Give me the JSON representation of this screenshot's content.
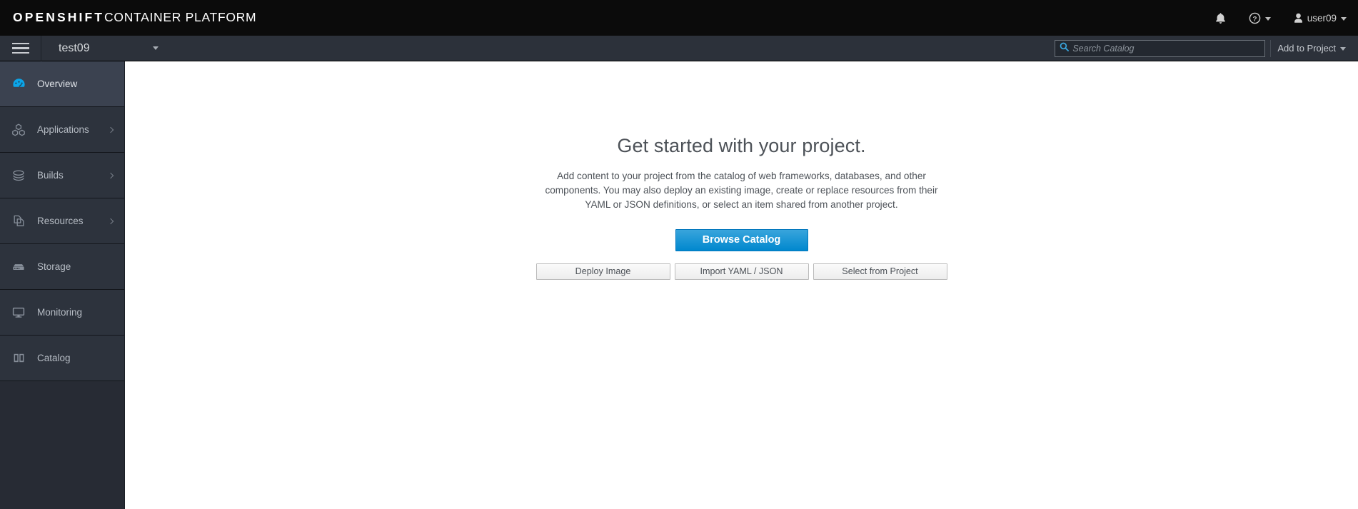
{
  "masthead": {
    "brand_bold": "OPENSHIFT",
    "brand_light": "CONTAINER PLATFORM",
    "notifications_icon": "bell-icon",
    "help_icon": "help-circle-icon",
    "user_icon": "user-icon",
    "username": "user09"
  },
  "toolbar": {
    "menu_icon": "hamburger-icon",
    "project_name": "test09",
    "search": {
      "icon": "search-icon",
      "placeholder": "Search Catalog",
      "value": ""
    },
    "add_to_project_label": "Add to Project"
  },
  "sidebar": {
    "items": [
      {
        "label": "Overview",
        "icon": "dashboard-gauge-icon",
        "active": true,
        "expandable": false
      },
      {
        "label": "Applications",
        "icon": "cubes-icon",
        "active": false,
        "expandable": true
      },
      {
        "label": "Builds",
        "icon": "layers-icon",
        "active": false,
        "expandable": true
      },
      {
        "label": "Resources",
        "icon": "copy-files-icon",
        "active": false,
        "expandable": true
      },
      {
        "label": "Storage",
        "icon": "database-icon",
        "active": false,
        "expandable": false
      },
      {
        "label": "Monitoring",
        "icon": "monitor-icon",
        "active": false,
        "expandable": false
      },
      {
        "label": "Catalog",
        "icon": "book-icon",
        "active": false,
        "expandable": false
      }
    ]
  },
  "main": {
    "title": "Get started with your project.",
    "description": "Add content to your project from the catalog of web frameworks, databases, and other components. You may also deploy an existing image, create or replace resources from their YAML or JSON definitions, or select an item shared from another project.",
    "primary_button": "Browse Catalog",
    "secondary_buttons": [
      "Deploy Image",
      "Import YAML / JSON",
      "Select from Project"
    ]
  },
  "colors": {
    "masthead_bg": "#0b0b0b",
    "toolbar_bg": "#2c313a",
    "sidebar_bg": "#272b34",
    "sidebar_item_bg": "#2d333d",
    "sidebar_active_bg": "#3b4250",
    "accent_blue": "#0088ce",
    "content_bg": "#ffffff",
    "text_muted": "#4d5258"
  }
}
